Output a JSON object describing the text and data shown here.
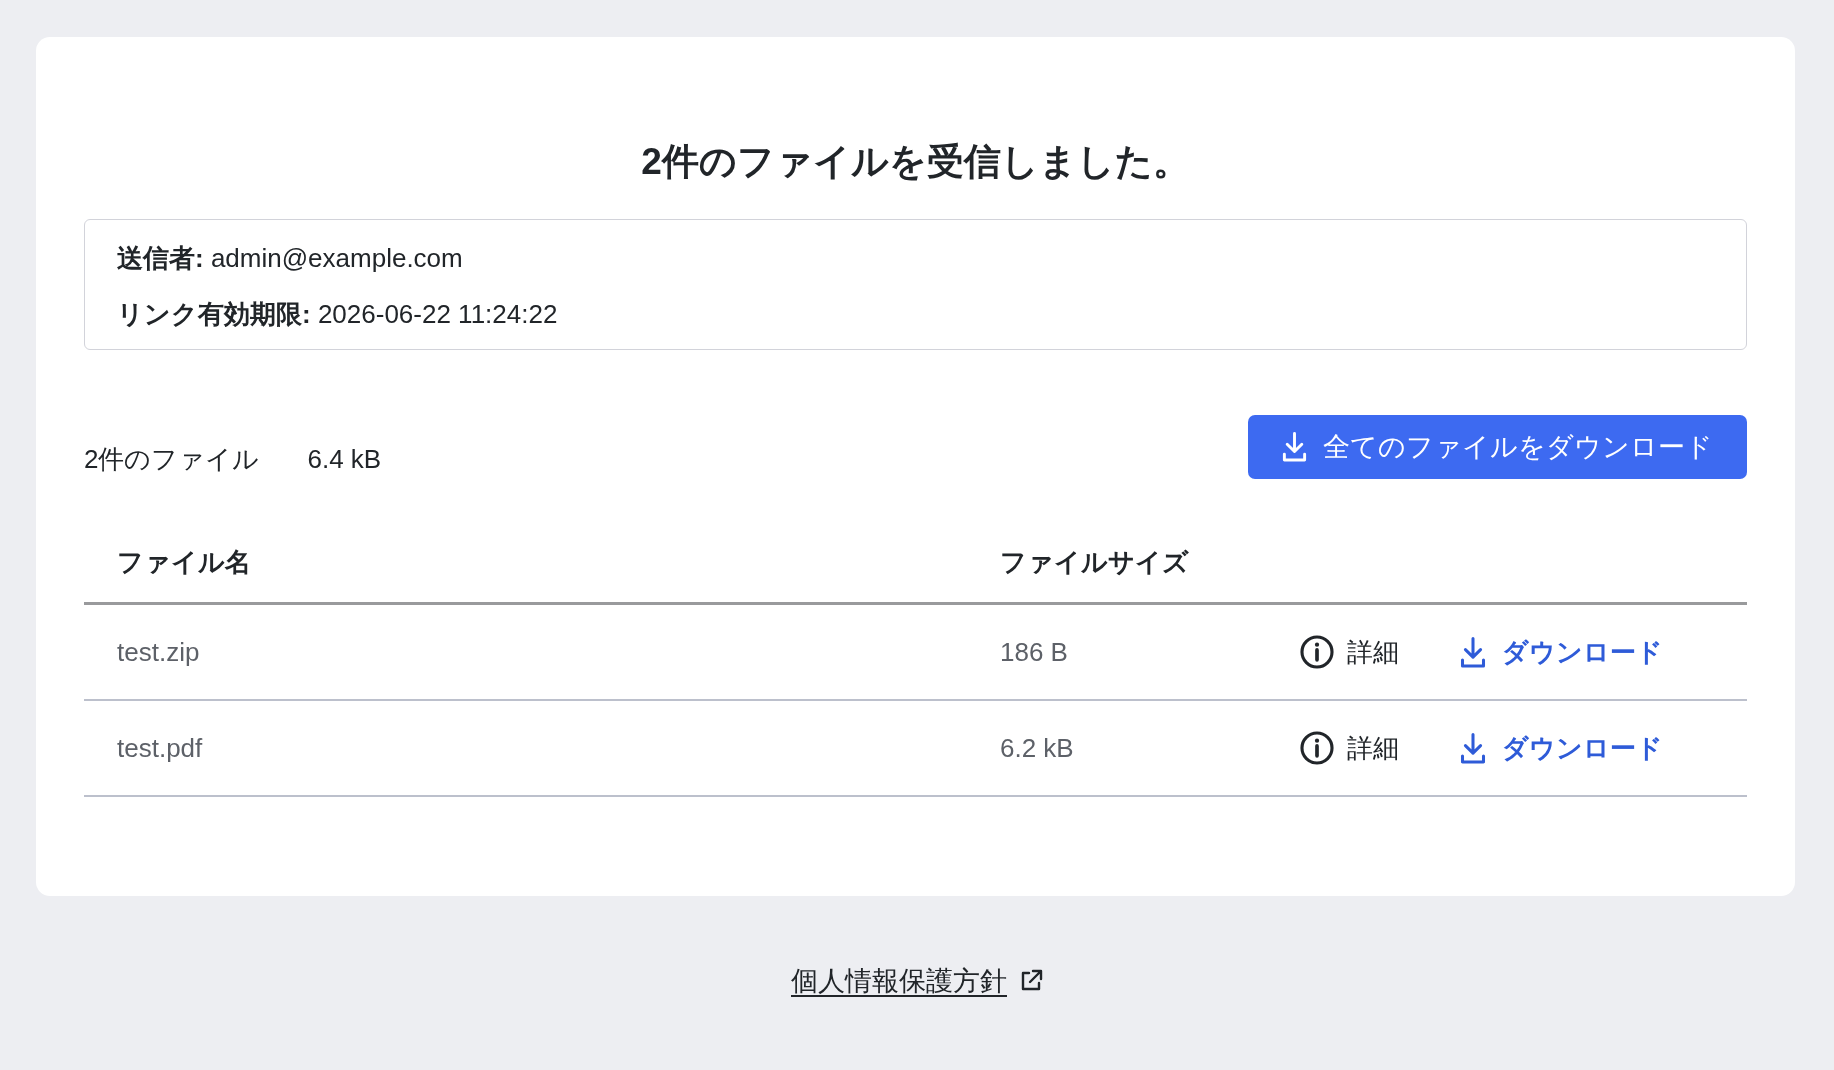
{
  "title": "2件のファイルを受信しました。",
  "info": [
    {
      "text": "**送信者:** admin@example.com"
    },
    {
      "text": "**リンク有効期限:** 2026-06-22 11:24:22"
    }
  ],
  "summary": {
    "file_count": "2件のファイル",
    "total_size": "6.4 kB"
  },
  "download_all_button": {
    "label": "全てのファイルをダウンロード"
  },
  "table": {
    "columns": [
      "ファイル名",
      "ファイルサイズ"
    ],
    "rows": [
      {
        "name": "test.zip",
        "size": "186 B",
        "details_link": "詳細",
        "download_link": "ダウンロード"
      },
      {
        "name": "test.pdf",
        "size": "6.2 kB",
        "details_link": "詳細",
        "download_link": "ダウンロード"
      }
    ]
  },
  "footer": {
    "privacy_link": "個人情報保護方針"
  }
}
